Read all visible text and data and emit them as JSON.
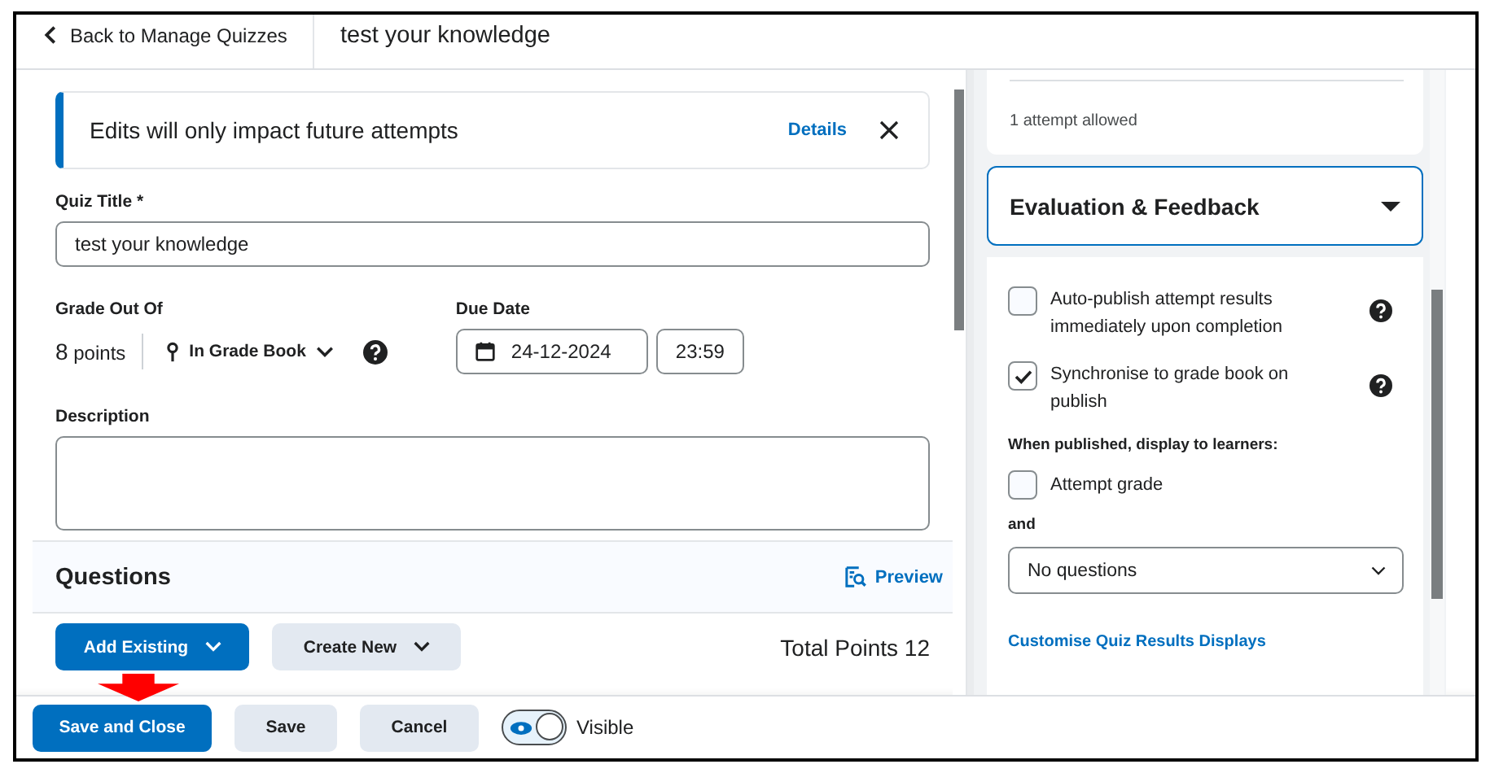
{
  "header": {
    "back_link": "Back to Manage Quizzes",
    "title": "test your knowledge"
  },
  "alert": {
    "message": "Edits will only impact future attempts",
    "link": "Details"
  },
  "quiz_title": {
    "label": "Quiz Title *",
    "value": "test your knowledge"
  },
  "grade": {
    "label": "Grade Out Of",
    "value": "8",
    "unit": "points",
    "grade_book": "In Grade Book"
  },
  "due_date": {
    "label": "Due Date",
    "date": "24-12-2024",
    "time": "23:59"
  },
  "description": {
    "label": "Description"
  },
  "questions": {
    "title": "Questions",
    "preview": "Preview",
    "total": "Total Points 12",
    "buttons": [
      {
        "label": "Add Existing",
        "kind": "primary"
      },
      {
        "label": "Create New",
        "kind": "secondary"
      }
    ]
  },
  "side_panel": {
    "attempts": "1 attempt allowed",
    "section": {
      "title": "Evaluation & Feedback",
      "expanded": true
    },
    "options": [
      {
        "label": "Auto-publish attempt results immediately upon completion",
        "checked": false
      },
      {
        "label": "Synchronise to grade book on publish",
        "checked": true
      }
    ],
    "display_label": "When published, display to learners:",
    "display_options": [
      {
        "label": "Attempt grade",
        "checked": false
      }
    ],
    "and_label": "and",
    "select": "No questions",
    "link": "Customise Quiz Results Displays"
  },
  "footer": {
    "buttons": [
      {
        "label": "Save and Close",
        "kind": "primary"
      },
      {
        "label": "Save",
        "kind": "secondary"
      },
      {
        "label": "Cancel",
        "kind": "secondary"
      }
    ],
    "visibility": {
      "label": "Visible",
      "on": true
    }
  }
}
